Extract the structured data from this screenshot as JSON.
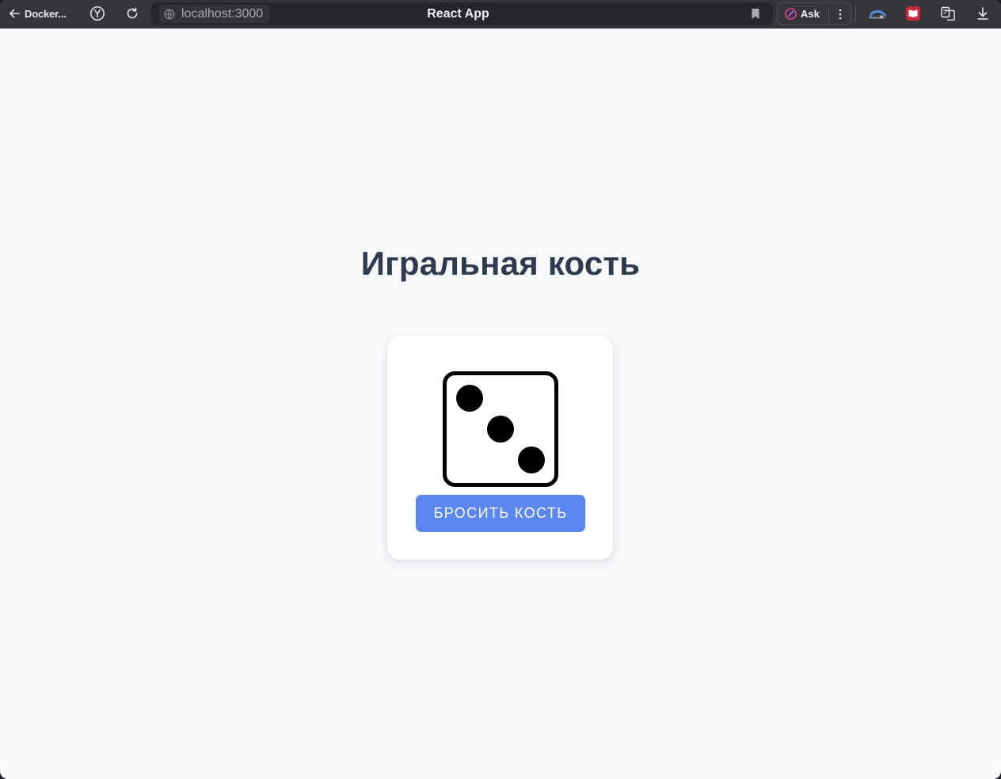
{
  "browser": {
    "back_label": "Docker...",
    "address": "localhost:3000",
    "tab_title": "React App",
    "ask_label": "Ask",
    "icons": {
      "back": "arrow-left-icon",
      "yandex": "yandex-icon",
      "reload": "reload-icon",
      "site": "globe-icon",
      "bookmark": "bookmark-icon",
      "ask": "ai-assistant-icon",
      "more": "more-vertical-icon",
      "cloud": "cloud-extension-icon",
      "reader": "reader-extension-icon",
      "translate": "translate-icon",
      "download": "download-icon"
    }
  },
  "page": {
    "heading": "Игральная кость",
    "roll_button_label": "БРОСИТЬ КОСТЬ",
    "die_value": 3
  },
  "colors": {
    "page_background": "#f8f9fb",
    "heading": "#2f3a4d",
    "button": "#5b88f0",
    "die": "#000000"
  }
}
